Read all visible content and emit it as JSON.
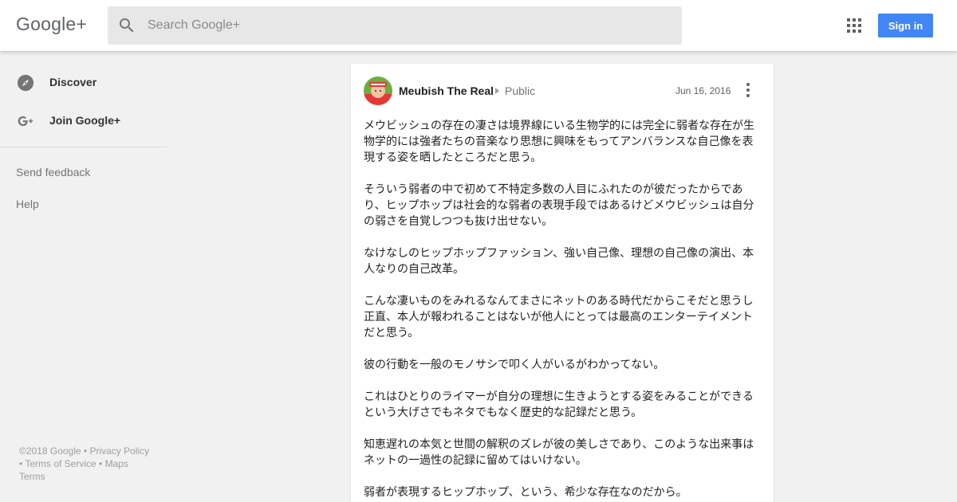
{
  "header": {
    "logo": "Google+",
    "search_placeholder": "Search Google+",
    "signin_label": "Sign in"
  },
  "sidebar": {
    "items": [
      {
        "label": "Discover",
        "icon": "compass-icon"
      },
      {
        "label": "Join Google+",
        "icon": "google-plus-icon"
      }
    ],
    "links": [
      "Send feedback",
      "Help"
    ]
  },
  "footer": {
    "copyright": "©2018 Google",
    "privacy": "Privacy Policy",
    "terms_of_service": "Terms of Service",
    "maps": "Maps",
    "terms": "Terms"
  },
  "post": {
    "author": "Meubish The Real",
    "visibility": "Public",
    "date": "Jun 16, 2016",
    "paragraphs": [
      "メウビッシュの存在の凄さは境界線にいる生物学的には完全に弱者な存在が生物学的には強者たちの音楽なり思想に興味をもってアンバランスな自己像を表現する姿を晒したところだと思う。",
      "そういう弱者の中で初めて不特定多数の人目にふれたのが彼だったからであり、ヒップホップは社会的な弱者の表現手段ではあるけどメウビッシュは自分の弱さを自覚しつつも抜け出せない。",
      "なけなしのヒップホップファッション、強い自己像、理想の自己像の演出、本人なりの自己改革。",
      "こんな凄いものをみれるなんてまさにネットのある時代だからこそだと思うし正直、本人が報われることはないが他人にとっては最高のエンターテイメントだと思う。",
      "彼の行動を一般のモノサシで叩く人がいるがわかってない。",
      "これはひとりのライマーが自分の理想に生きようとする姿をみることができるという大げさでもネタでもなく歴史的な記録だと思う。",
      "知恵遅れの本気と世間の解釈のズレが彼の美しさであり、このような出来事はネットの一過性の記録に留めてはいけない。",
      "弱者が表現するヒップホップ、という、希少な存在なのだから。"
    ]
  },
  "colors": {
    "accent": "#4285f4",
    "background": "#f1f1f1",
    "card": "#ffffff"
  }
}
